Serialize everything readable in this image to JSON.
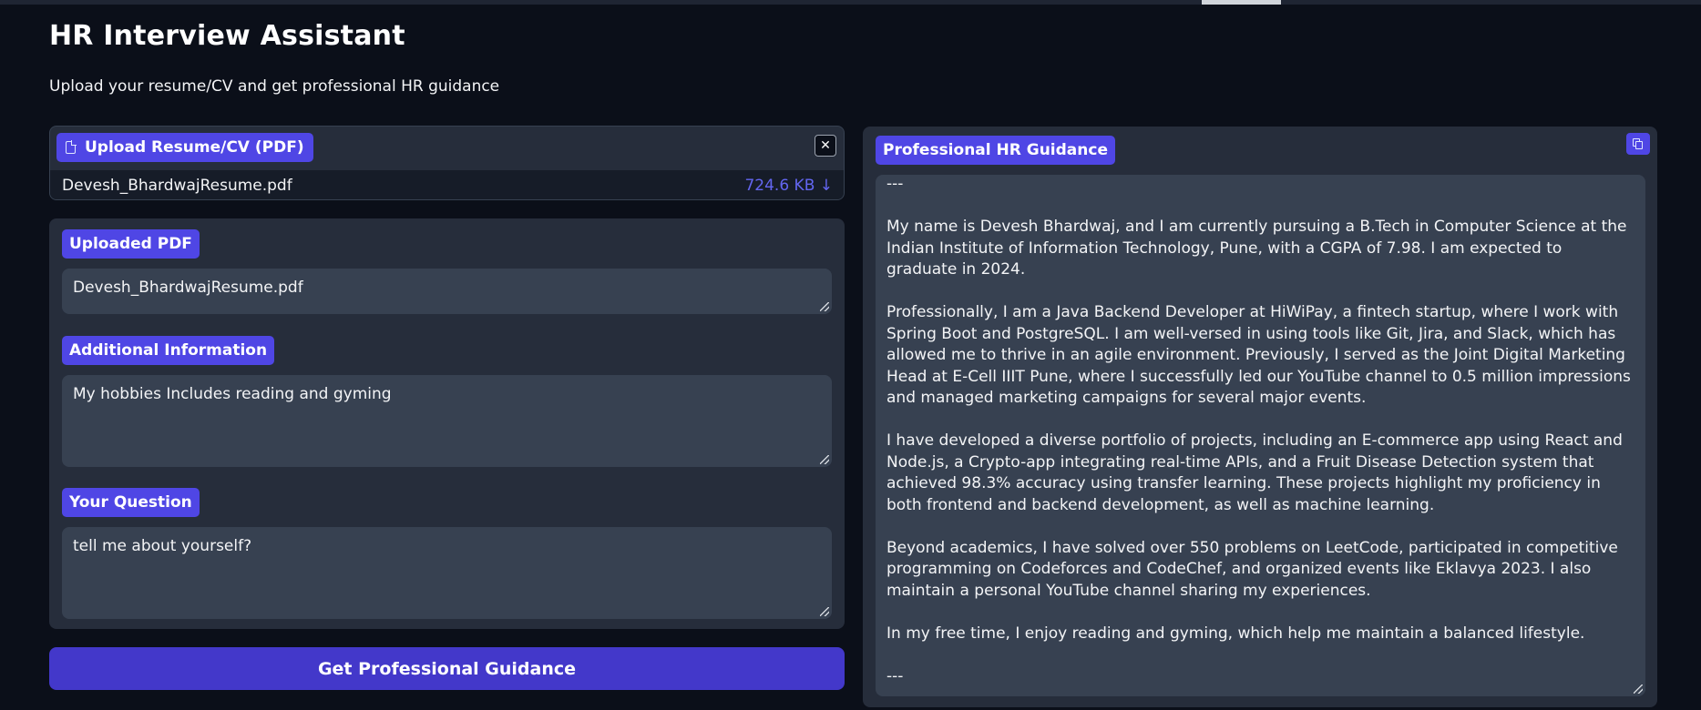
{
  "app": {
    "title": "HR Interview Assistant",
    "subtitle": "Upload your resume/CV and get professional HR guidance"
  },
  "upload": {
    "label": "Upload Resume/CV (PDF)",
    "file_name": "Devesh_BhardwajResume.pdf",
    "file_size": "724.6 KB ↓",
    "close_icon": "✕"
  },
  "form": {
    "uploaded_pdf_label": "Uploaded PDF",
    "uploaded_pdf_value": "Devesh_BhardwajResume.pdf",
    "additional_info_label": "Additional Information",
    "additional_info_value": "My hobbies Includes reading and gyming",
    "question_label": "Your Question",
    "question_value": "tell me about yourself?",
    "submit_label": "Get Professional Guidance"
  },
  "output": {
    "label": "Professional HR Guidance",
    "paragraphs": [
      "---",
      "My name is Devesh Bhardwaj, and I am currently pursuing a B.Tech in Computer Science at the Indian Institute of Information Technology, Pune, with a CGPA of 7.98. I am expected to graduate in 2024.",
      "Professionally, I am a Java Backend Developer at HiWiPay, a fintech startup, where I work with Spring Boot and PostgreSQL. I am well-versed in using tools like Git, Jira, and Slack, which has allowed me to thrive in an agile environment. Previously, I served as the Joint Digital Marketing Head at E-Cell IIIT Pune, where I successfully led our YouTube channel to 0.5 million impressions and managed marketing campaigns for several major events.",
      "I have developed a diverse portfolio of projects, including an E-commerce app using React and Node.js, a Crypto-app integrating real-time APIs, and a Fruit Disease Detection system that achieved 98.3% accuracy using transfer learning. These projects highlight my proficiency in both frontend and backend development, as well as machine learning.",
      "Beyond academics, I have solved over 550 problems on LeetCode, participated in competitive programming on Codeforces and CodeChef, and organized events like Eklavya 2023. I also maintain a personal YouTube channel sharing my experiences.",
      "In my free time, I enjoy reading and gyming, which help me maintain a balanced lifestyle.",
      "---"
    ]
  },
  "colors": {
    "background": "#0b0f19",
    "panel": "#262d3b",
    "field": "#374151",
    "accent": "#4f46e5",
    "button": "#4338ca",
    "file_size": "#6366f1"
  },
  "icons": {
    "upload": "file-icon",
    "close": "close-icon",
    "copy": "copy-icon",
    "resize": "resize-handle-icon"
  }
}
